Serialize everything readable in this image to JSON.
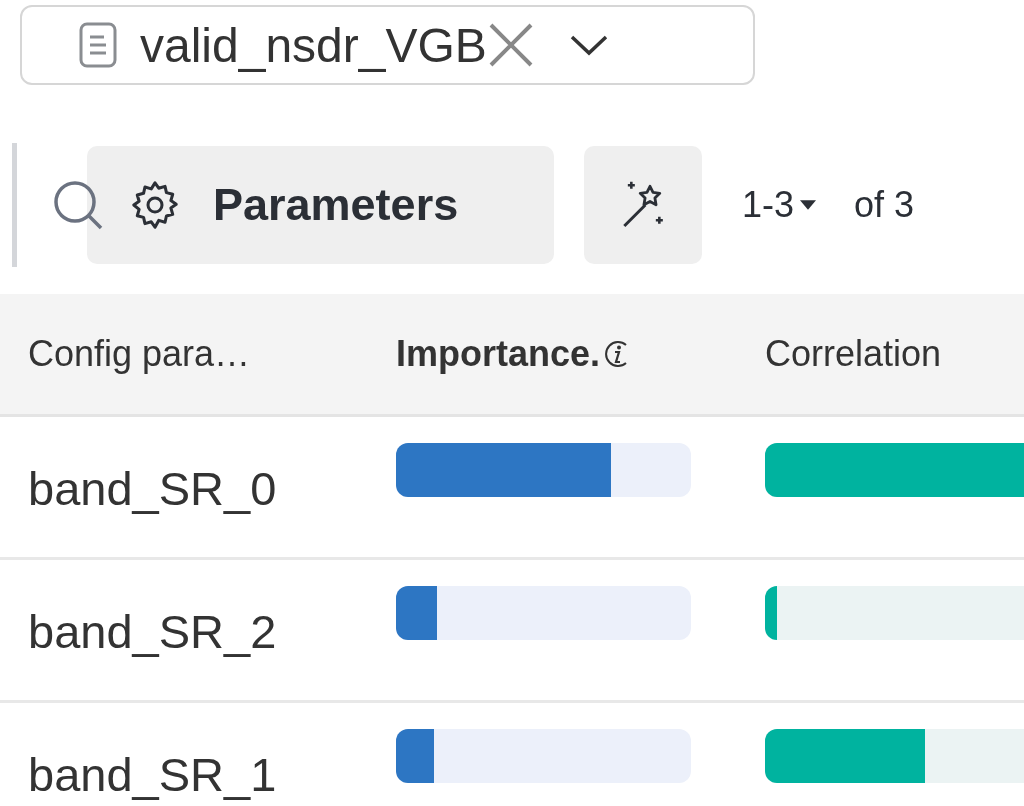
{
  "run_selector": {
    "value": "valid_nsdr_VGB"
  },
  "toolbar": {
    "button": "Parameters",
    "pagination": "1-3",
    "total": "of 3"
  },
  "table": {
    "columns": [
      "Config para…",
      "Importance.",
      "Correlation"
    ],
    "rows": [
      {
        "name": "band_SR_0",
        "importance": {
          "level": 0.73
        },
        "correlation": {
          "level": 0.66
        }
      },
      {
        "name": "band_SR_2",
        "importance": {
          "level": 0.14
        },
        "correlation": {
          "level": 0.03
        }
      },
      {
        "name": "band_SR_1",
        "importance": {
          "level": 0.13
        },
        "correlation": {
          "level": 0.4
        }
      }
    ]
  }
}
